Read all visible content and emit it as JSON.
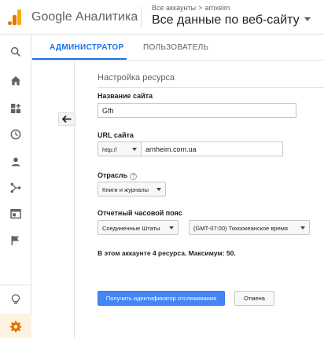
{
  "header": {
    "brand": "Google Аналитика",
    "breadcrumb": {
      "all_accounts": "Все аккаунты",
      "separator": ">",
      "account": "arnxeim"
    },
    "view_selector": "Все данные по веб-сайту"
  },
  "sidebar": {
    "items": [
      {
        "icon": "search-icon"
      },
      {
        "icon": "home-icon"
      },
      {
        "icon": "customization-icon"
      },
      {
        "icon": "realtime-icon"
      },
      {
        "icon": "audience-icon"
      },
      {
        "icon": "acquisition-icon"
      },
      {
        "icon": "behavior-icon"
      },
      {
        "icon": "conversions-icon"
      },
      {
        "icon": "discover-icon"
      },
      {
        "icon": "admin-gear-icon"
      }
    ],
    "active_color": "#e37400"
  },
  "tabs": [
    {
      "label": "АДМИНИСТРАТОР",
      "active": true
    },
    {
      "label": "ПОЛЬЗОВАТЕЛЬ",
      "active": false
    }
  ],
  "form": {
    "section_title": "Настройка ресурса",
    "site_name": {
      "label": "Название сайта",
      "value": "Gfh"
    },
    "site_url": {
      "label": "URL сайта",
      "protocol": "http://",
      "value": "arnheim.com.ua"
    },
    "industry": {
      "label": "Отрасль",
      "help": "?",
      "value": "Книги и журналы"
    },
    "timezone": {
      "label": "Отчетный часовой пояс",
      "country": "Соединенные Штаты",
      "zone": "(GMT-07:00) Тихоокеанское время"
    },
    "info_text": "В этом аккаунте 4 ресурса. Максимум: 50.",
    "submit_label": "Получить идентификатор отслеживания",
    "cancel_label": "Отмена"
  },
  "colors": {
    "accent": "#1a73e8",
    "primary_button": "#4285f4",
    "brand_orange": "#f9ab00"
  }
}
